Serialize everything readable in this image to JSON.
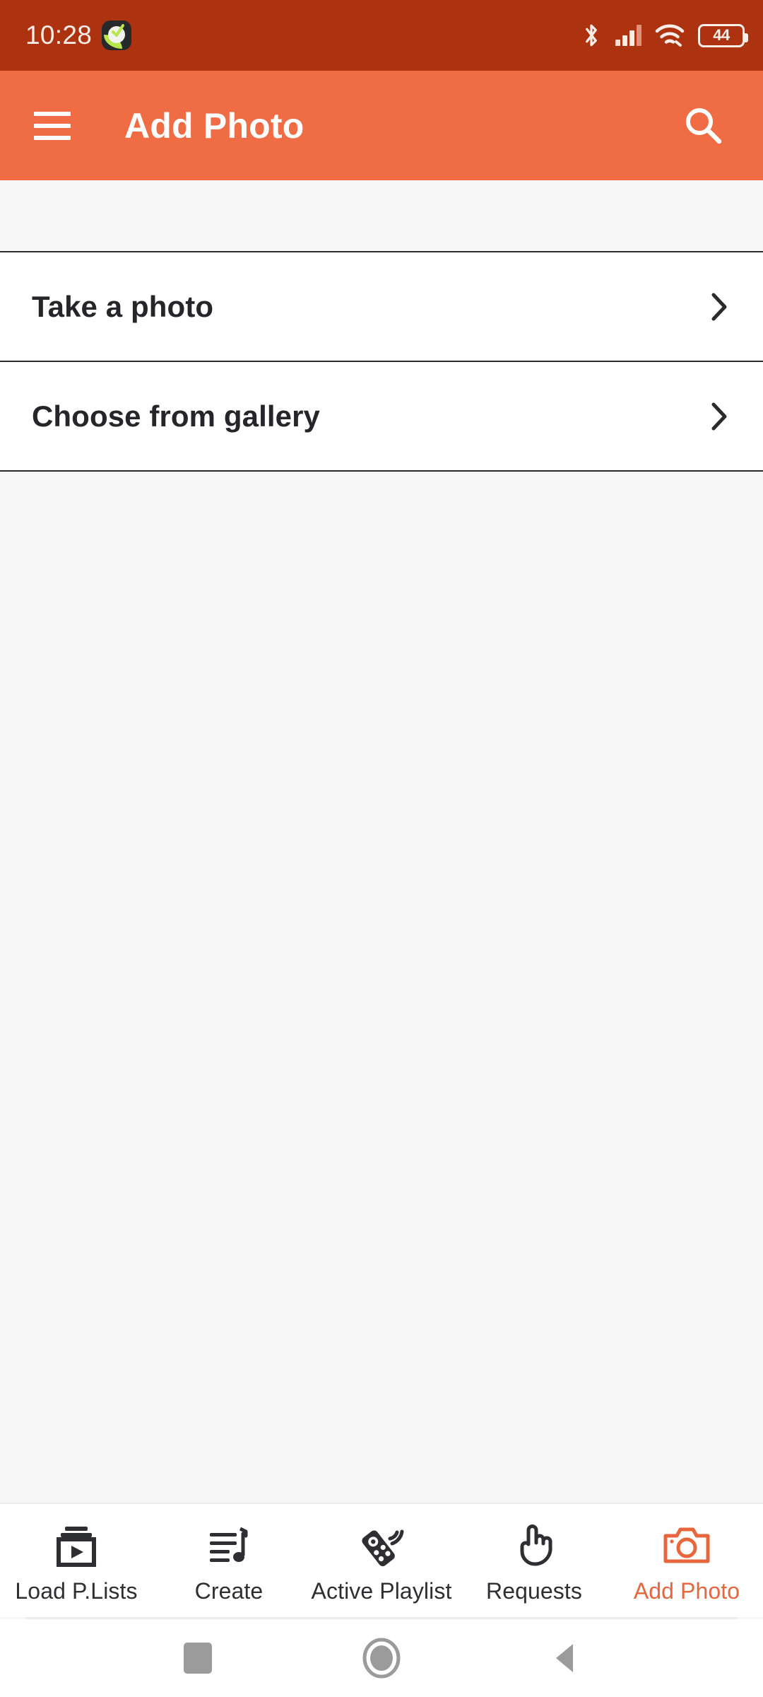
{
  "status_bar": {
    "clock": "10:28",
    "app_icon_name": "notification-app-icon",
    "bluetooth_icon": "bluetooth-icon",
    "signal_icon": "cellular-signal-icon",
    "wifi_icon": "wifi-icon",
    "battery_level": "44",
    "background_color": "#ad3310",
    "foreground_color": "#fbeee9"
  },
  "app_bar": {
    "menu_icon": "hamburger-menu-icon",
    "title": "Add Photo",
    "search_icon": "search-icon",
    "background_color": "#f06c45",
    "text_color": "#ffffff"
  },
  "main": {
    "options": [
      {
        "label": "Take a photo",
        "chevron": "chevron-right-icon"
      },
      {
        "label": "Choose from gallery",
        "chevron": "chevron-right-icon"
      }
    ],
    "background_color": "#f7f7f7"
  },
  "bottom_nav": {
    "active_color": "#e8663c",
    "inactive_color": "#2d2f33",
    "items": [
      {
        "label": "Load P.Lists",
        "icon": "playlist-play-icon",
        "active": false
      },
      {
        "label": "Create",
        "icon": "queue-music-icon",
        "active": false
      },
      {
        "label": "Active Playlist",
        "icon": "remote-control-icon",
        "active": false
      },
      {
        "label": "Requests",
        "icon": "pointing-hand-icon",
        "active": false
      },
      {
        "label": "Add Photo",
        "icon": "camera-icon",
        "active": true
      }
    ]
  },
  "android_nav": {
    "recents_icon": "recents-square-icon",
    "home_icon": "home-circle-icon",
    "back_icon": "back-triangle-icon",
    "color": "#9b9b9b"
  }
}
